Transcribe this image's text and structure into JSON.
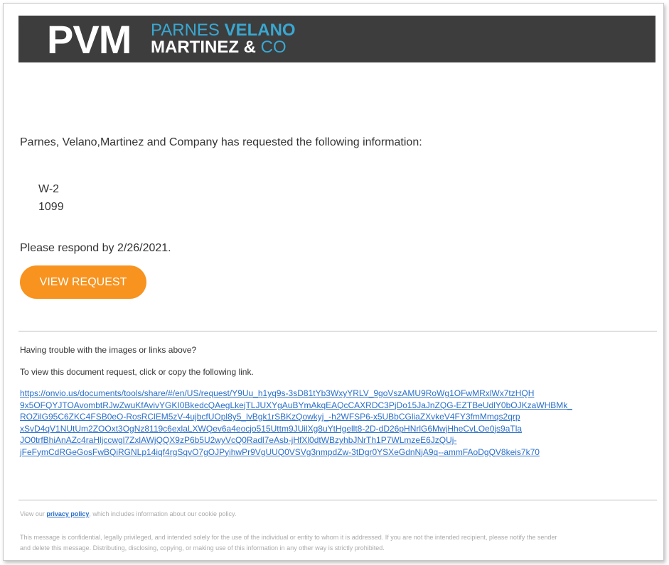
{
  "header": {
    "logo_mark": "PVM",
    "logo_line1_a": "PARNES",
    "logo_line1_b": "VELANO",
    "logo_line2_a": "MARTINEZ",
    "logo_line2_b": "&",
    "logo_line2_c": "CO",
    "colors": {
      "banner": "#3d3d3d",
      "accent": "#3aa7d1"
    }
  },
  "body": {
    "intro": "Parnes, Velano,Martinez and Company has requested the following information:",
    "requested_items": [
      "W-2",
      "1099"
    ],
    "respond_by": "Please respond by 2/26/2021.",
    "view_request_label": "VIEW REQUEST",
    "button_color": "#f7931e"
  },
  "help": {
    "trouble": "Having trouble with the images or links above?",
    "instruction": "To view this document request, click or copy the following link.",
    "link_lines": [
      "https://onvio.us/documents/tools/share/#/en/US/request/Y9Uu_h1yq9s-3sD81tYb3WxyYRLV_9goVszAMU9RoWg1OFwMRxlWx7tzHQH",
      "9x5OFQYJTOAvombtRJwZwuKfAvivYGKI0BkedcQAegLkejTLJUXYgAuBYmAkqEAQcCAXRDC3PjDo15JaJnZQG-EZTBeUdlY0bOJKzaWHBMk_",
      "ROZilG95C6ZKC4FSB0eO-RosRClEM5zV-4ujbcfUOpl8y5_lvBgk1rSBKzQowkyj_-h2WFSP6-x5UBbCGliaZXvkeV4FY3fmMmqs2qrp",
      "xSvD4qV1NUtUm2ZOOxt3OgNz8119c6exlaLXWQev6a4eocjo515Uttm9JUilXg8uYtHgellt8-2D-dD26pHNrlG6MwjHheCvLOe0js9aTla",
      "JO0trfBhiAnAZc4raHljccwgl7ZxlAWjQQX9zP6b5U2wyVcQ0Radl7eAsb-jHfXl0dtWBzyhbJNrTh1P7WLmzeE6JzQUj-",
      "jFeFymCdRGeGosFwBQiRGNLp14iqf4rgSqvO7gOJPyihwPr9VgUUQ0VSVg3nmpdZw-3tDgr0YSXeGdnNjA9q--ammFAoDgQV8keis7k70"
    ]
  },
  "footer": {
    "policy_prefix": "View our",
    "policy_link": "privacy policy",
    "policy_suffix": ", which includes information about our cookie policy.",
    "confidential_line1": "This message is confidential, legally privileged, and intended solely for the use of the individual or entity to whom it is addressed. If you are not the intended recipient, please notify the sender",
    "confidential_line2": "and delete this message. Distributing, disclosing, copying, or making use of this information in any other way is strictly prohibited."
  }
}
